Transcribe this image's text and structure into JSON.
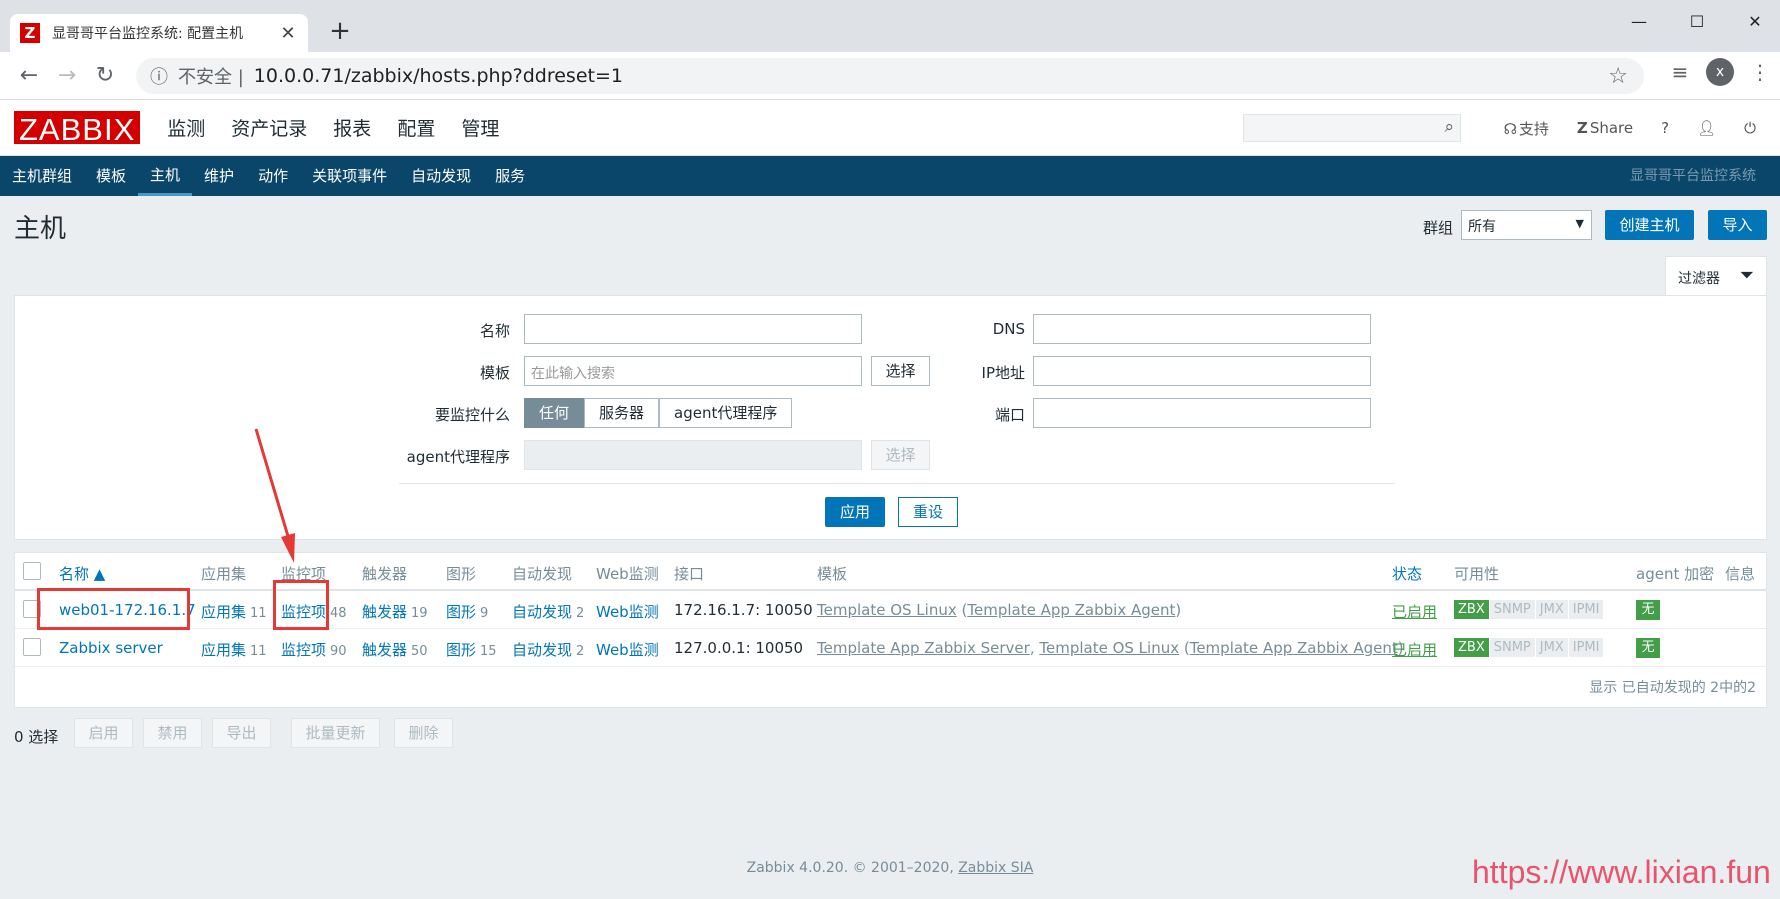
{
  "browser": {
    "tab_title": "显哥哥平台监控系统: 配置主机",
    "favicon": "Z",
    "insecure_label": "不安全 |",
    "url": "10.0.0.71/zabbix/hosts.php?ddreset=1",
    "avatar": "x"
  },
  "header": {
    "logo": "ZABBIX",
    "menu": [
      "监测",
      "资产记录",
      "报表",
      "配置",
      "管理"
    ],
    "support": "支持",
    "share": "Share"
  },
  "subnav": {
    "items": [
      "主机群组",
      "模板",
      "主机",
      "维护",
      "动作",
      "关联项事件",
      "自动发现",
      "服务"
    ],
    "server_name": "显哥哥平台监控系统"
  },
  "page": {
    "title": "主机",
    "group_label": "群组",
    "group_value": "所有",
    "create_host": "创建主机",
    "import": "导入"
  },
  "filter": {
    "tab_label": "过滤器",
    "name_label": "名称",
    "template_label": "模板",
    "template_placeholder": "在此输入搜索",
    "select": "选择",
    "monitored_label": "要监控什么",
    "monitored_options": [
      "任何",
      "服务器",
      "agent代理程序"
    ],
    "proxy_label": "agent代理程序",
    "dns_label": "DNS",
    "ip_label": "IP地址",
    "port_label": "端口",
    "apply": "应用",
    "reset": "重设"
  },
  "table": {
    "headers": {
      "name": "名称 ▲",
      "applications": "应用集",
      "items": "监控项",
      "triggers": "触发器",
      "graphs": "图形",
      "discovery": "自动发现",
      "web": "Web监测",
      "interface": "接口",
      "templates": "模板",
      "status": "状态",
      "availability": "可用性",
      "encryption": "agent 加密",
      "info": "信息"
    },
    "rows": [
      {
        "name": "web01-172.16.1.7",
        "applications": "应用集",
        "applications_count": "11",
        "items": "监控项",
        "items_count": "48",
        "triggers": "触发器",
        "triggers_count": "19",
        "graphs": "图形",
        "graphs_count": "9",
        "discovery": "自动发现",
        "discovery_count": "2",
        "web": "Web监测",
        "interface": "172.16.1.7: 10050",
        "tpl1": "Template OS Linux",
        "tpl_sep": " (",
        "tpl2": "Template App Zabbix Agent",
        "tpl_end": ")",
        "status": "已启用",
        "zbx": "ZBX",
        "snmp": "SNMP",
        "jmx": "JMX",
        "ipmi": "IPMI",
        "encryption": "无"
      },
      {
        "name": "Zabbix server",
        "applications": "应用集",
        "applications_count": "11",
        "items": "监控项",
        "items_count": "90",
        "triggers": "触发器",
        "triggers_count": "50",
        "graphs": "图形",
        "graphs_count": "15",
        "discovery": "自动发现",
        "discovery_count": "2",
        "web": "Web监测",
        "interface": "127.0.0.1: 10050",
        "tpl1": "Template App Zabbix Server",
        "tpl_comma": ", ",
        "tpl1b": "Template OS Linux",
        "tpl_sep": " (",
        "tpl2": "Template App Zabbix Agent",
        "tpl_end": ")",
        "status": "已启用",
        "zbx": "ZBX",
        "snmp": "SNMP",
        "jmx": "JMX",
        "ipmi": "IPMI",
        "encryption": "无"
      }
    ],
    "footer": "显示 已自动发现的 2中的2"
  },
  "actions": {
    "selected": "0 选择",
    "buttons": [
      "启用",
      "禁用",
      "导出",
      "批量更新",
      "删除"
    ]
  },
  "footer": {
    "text": "Zabbix 4.0.20. © 2001–2020,",
    "link": "Zabbix SIA"
  },
  "watermark": "https://www.lixian.fun",
  "colors": {
    "brand": "#d40000",
    "nav": "#0a466a",
    "link": "#0275b8",
    "status_ok": "#429e47",
    "annotation": "#e53935"
  }
}
